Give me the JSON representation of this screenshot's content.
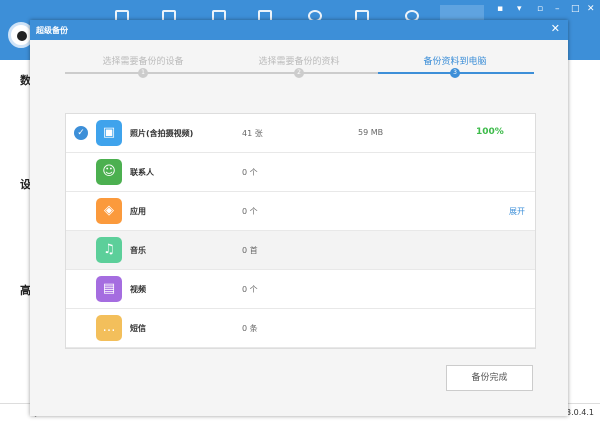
{
  "app": {
    "side_labels": [
      "数",
      "设",
      "高"
    ],
    "status_user": "lyl",
    "version": "3.0.4.1"
  },
  "dialog": {
    "title": "超级备份",
    "steps": [
      {
        "label": "选择需要备份的设备",
        "num": "1"
      },
      {
        "label": "选择需要备份的资料",
        "num": "2"
      },
      {
        "label": "备份资料到电脑",
        "num": "3"
      }
    ],
    "items": [
      {
        "name": "照片(含拍摄视频)",
        "count": "41 张",
        "size": "59 MB",
        "progress": "100%",
        "checked": true,
        "color": "#3fa3ec",
        "icon": "image-icon",
        "glyph": "▣"
      },
      {
        "name": "联系人",
        "count": "0 个",
        "color": "#4cb050",
        "icon": "contact-icon",
        "glyph": "☺"
      },
      {
        "name": "应用",
        "count": "0 个",
        "action": "展开",
        "color": "#fb9a3c",
        "icon": "apps-icon",
        "glyph": "◈"
      },
      {
        "name": "音乐",
        "count": "0 首",
        "color": "#5ccf9a",
        "icon": "music-icon",
        "glyph": "♫"
      },
      {
        "name": "视频",
        "count": "0 个",
        "color": "#a56de0",
        "icon": "video-icon",
        "glyph": "▤"
      },
      {
        "name": "短信",
        "count": "0 条",
        "color": "#f3bf5b",
        "icon": "message-icon",
        "glyph": "…"
      }
    ],
    "done_button": "备份完成"
  }
}
